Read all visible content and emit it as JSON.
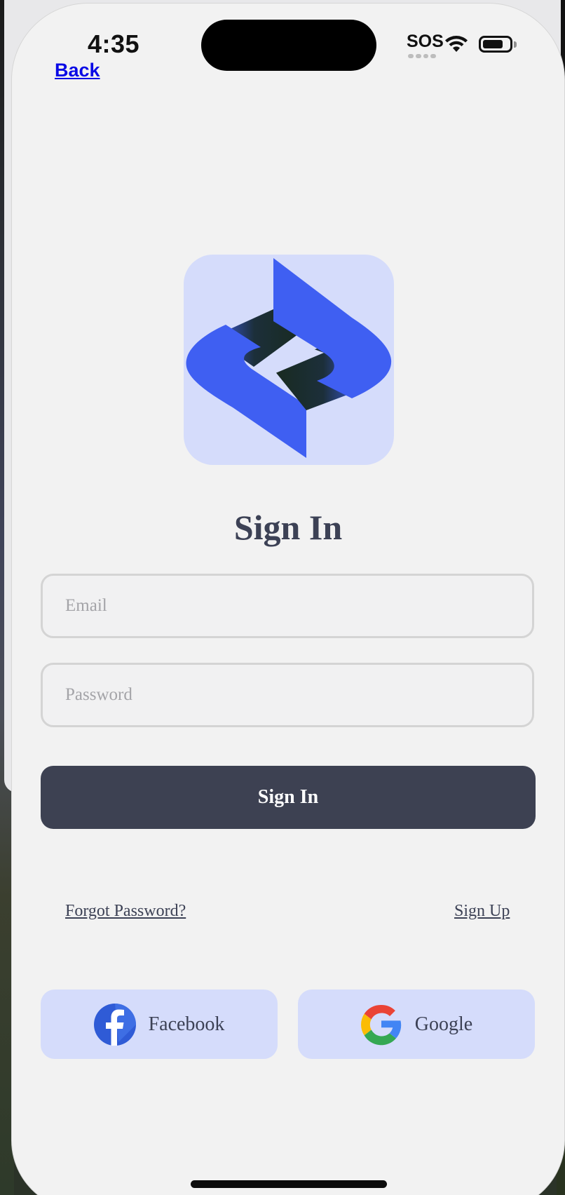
{
  "status_bar": {
    "time": "4:35",
    "carrier_status": "SOS",
    "icons": [
      "wifi-icon",
      "battery-icon"
    ]
  },
  "nav": {
    "back_label": "Back"
  },
  "logo": {
    "icon": "app-logo",
    "tile_color": "#d5dcfb",
    "brand_color": "#3f5ff2"
  },
  "form": {
    "title": "Sign In",
    "email_placeholder": "Email",
    "password_placeholder": "Password",
    "submit_label": "Sign In"
  },
  "links": {
    "forgot_password": "Forgot Password?",
    "sign_up": "Sign Up"
  },
  "social": {
    "facebook_label": "Facebook",
    "google_label": "Google"
  },
  "colors": {
    "primary_dark": "#3d4152",
    "background": "#f2f2f2",
    "social_bg": "#d5dcfb",
    "link_blue": "#0a0ae6"
  }
}
